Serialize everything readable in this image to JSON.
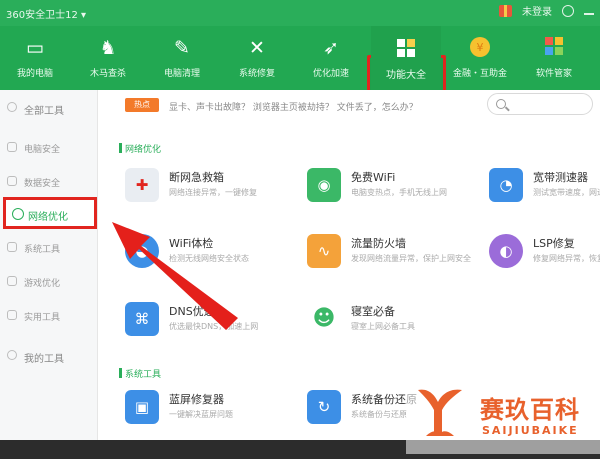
{
  "titlebar": {
    "title": "360安全卫士12 ▾",
    "right_label": "未登录"
  },
  "toolbar": [
    {
      "label": "我的电脑",
      "icon": "monitor-icon",
      "glyph": "▭"
    },
    {
      "label": "木马查杀",
      "icon": "horse-icon",
      "glyph": "♞"
    },
    {
      "label": "电脑清理",
      "icon": "broom-icon",
      "glyph": "✎"
    },
    {
      "label": "系统修复",
      "icon": "wrench-icon",
      "glyph": "✕"
    },
    {
      "label": "优化加速",
      "icon": "rocket-icon",
      "glyph": "➶"
    },
    {
      "label": "功能大全",
      "icon": "apps-grid-icon",
      "glyph": "▦"
    },
    {
      "label": "金融・互助金",
      "icon": "coin-icon",
      "glyph": "●"
    },
    {
      "label": "软件管家",
      "icon": "software-icon",
      "glyph": "❖"
    }
  ],
  "sidebar": {
    "all_tools": "全部工具",
    "items": [
      "电脑安全",
      "数据安全",
      "网络优化",
      "系统工具",
      "游戏优化",
      "实用工具"
    ],
    "my_tools": "我的工具"
  },
  "hot": {
    "badge": "热点",
    "text": "显卡、声卡出故障？  浏览器主页被劫持？  文件丢了，怎么办？"
  },
  "sections": {
    "network": "网络优化",
    "system": "系统工具"
  },
  "cards": [
    {
      "title": "断网急救箱",
      "desc": "网络连接异常，一键修复",
      "icon": "first-aid-icon",
      "color": "#e9edf2",
      "glyph": "✚"
    },
    {
      "title": "免费WiFi",
      "desc": "电脑变热点，手机无线上网",
      "icon": "wifi-icon",
      "color": "#3bb867",
      "glyph": "◉"
    },
    {
      "title": "宽带测速器",
      "desc": "测试宽带速度，网速快不快",
      "icon": "speedometer-icon",
      "color": "#3d8fe6",
      "glyph": "◔"
    },
    {
      "title": "WiFi体检",
      "desc": "检测无线网络安全状态",
      "icon": "wifi-check-icon",
      "color": "#3d8fe6",
      "glyph": "◕"
    },
    {
      "title": "流量防火墙",
      "desc": "发现网络流量异常，保护上网安全",
      "icon": "firewall-icon",
      "color": "#f4a23a",
      "glyph": "∿"
    },
    {
      "title": "LSP修复",
      "desc": "修复网络异常，恢复上网",
      "icon": "lsp-repair-icon",
      "color": "#9b6cd9",
      "glyph": "◐"
    },
    {
      "title": "DNS优选",
      "desc": "优选最快DNS，加速上网",
      "icon": "dns-icon",
      "color": "#3d8fe6",
      "glyph": "⌘"
    },
    {
      "title": "寝室必备",
      "desc": "寝室上网必备工具",
      "icon": "dorm-icon",
      "color": "#3bb867",
      "glyph": "☻"
    },
    {
      "title": "蓝屏修复器",
      "desc": "一键解决蓝屏问题",
      "icon": "bluescreen-icon",
      "color": "#3d8fe6",
      "glyph": "▣"
    },
    {
      "title": "系统备份还原",
      "desc": "系统备份与还原",
      "icon": "backup-icon",
      "color": "#3d8fe6",
      "glyph": "↻"
    }
  ],
  "watermark": {
    "cn": "赛玖百科",
    "en": "SAIJIUBAIKE"
  },
  "colors": {
    "brand": "#22a852",
    "highlight": "#e1251f",
    "watermark": "#e8612c"
  }
}
